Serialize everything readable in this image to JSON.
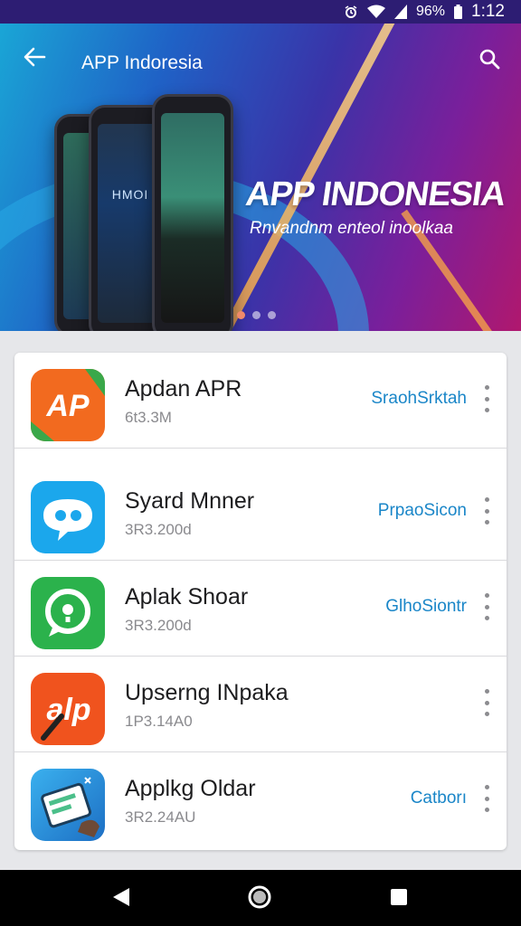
{
  "status_bar": {
    "battery": "96%",
    "time": "1:12"
  },
  "header": {
    "title": "APP Indoresia"
  },
  "banner": {
    "headline": "APP INDONESIA",
    "tagline": "Rnvandnm enteol inoolkaa",
    "screen_text": "HMOI",
    "dots": 3
  },
  "apps": [
    {
      "name": "Apdan APR",
      "sub": "6t3.3M",
      "action": "SraohSrktah",
      "icon": "ap-logo-icon",
      "color": "#f26a1f"
    },
    {
      "name": "Syard Mnner",
      "sub": "3R3.200d",
      "action": "PrpaoSicon",
      "icon": "chat-bubble-icon",
      "color": "#1ba7ec"
    },
    {
      "name": "Aplak Shoar",
      "sub": "3R3.200d",
      "action": "GlhoSiontr",
      "icon": "whatsapp-icon",
      "color": "#2bb24c"
    },
    {
      "name": "Upserng INpaka",
      "sub": "1P3.14A0",
      "action": "",
      "icon": "alp-logo-icon",
      "color": "#f0531e"
    },
    {
      "name": "Applkg Oldar",
      "sub": "3R2.24AU",
      "action": "Catborı",
      "icon": "tablet-hand-icon",
      "color": "#2a8fd8"
    }
  ]
}
